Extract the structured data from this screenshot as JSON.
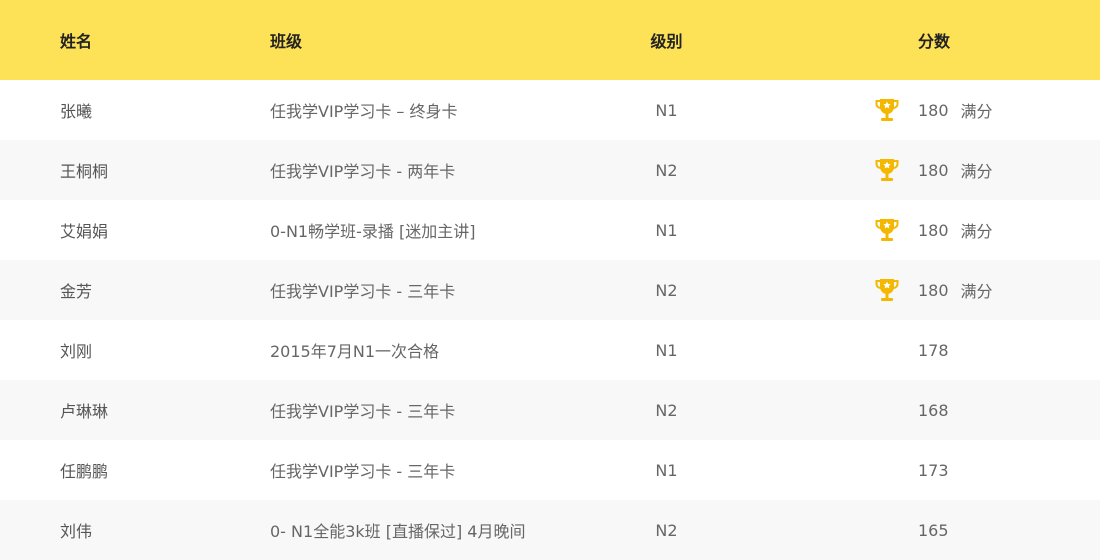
{
  "header": {
    "name": "姓名",
    "class": "班级",
    "level": "级别",
    "score": "分数"
  },
  "colors": {
    "header_bg": "#FDE257",
    "alt_row_bg": "#F8F8F8",
    "trophy": "#F5B800"
  },
  "rows": [
    {
      "name": "张曦",
      "class": "任我学VIP学习卡 – 终身卡",
      "level": "N1",
      "score": "180",
      "note": "满分",
      "trophy": true
    },
    {
      "name": "王桐桐",
      "class": "任我学VIP学习卡 - 两年卡",
      "level": "N2",
      "score": "180",
      "note": "满分",
      "trophy": true
    },
    {
      "name": "艾娟娟",
      "class": "0-N1畅学班-录播 [迷加主讲]",
      "level": "N1",
      "score": "180",
      "note": "满分",
      "trophy": true
    },
    {
      "name": "金芳",
      "class": "任我学VIP学习卡 - 三年卡",
      "level": "N2",
      "score": "180",
      "note": "满分",
      "trophy": true
    },
    {
      "name": "刘刚",
      "class": "2015年7月N1一次合格",
      "level": "N1",
      "score": "178",
      "note": "",
      "trophy": false
    },
    {
      "name": "卢琳琳",
      "class": "任我学VIP学习卡 - 三年卡",
      "level": "N2",
      "score": "168",
      "note": "",
      "trophy": false
    },
    {
      "name": "任鹏鹏",
      "class": "任我学VIP学习卡 - 三年卡",
      "level": "N1",
      "score": "173",
      "note": "",
      "trophy": false
    },
    {
      "name": "刘伟",
      "class": "0- N1全能3k班 [直播保过] 4月晚间",
      "level": "N2",
      "score": "165",
      "note": "",
      "trophy": false
    }
  ]
}
